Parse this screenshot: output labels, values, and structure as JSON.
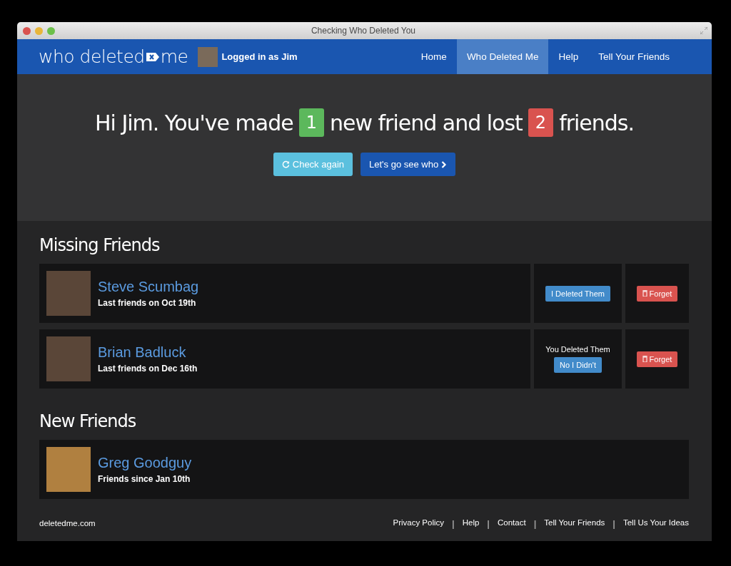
{
  "window": {
    "title": "Checking Who Deleted You"
  },
  "navbar": {
    "logo_left": "who deleted",
    "logo_right": "me",
    "login_prefix": "Logged in as",
    "login_user": "Jim",
    "items": [
      {
        "label": "Home",
        "selected": false
      },
      {
        "label": "Who Deleted Me",
        "selected": true
      },
      {
        "label": "Help",
        "selected": false
      },
      {
        "label": "Tell Your Friends",
        "selected": false
      }
    ]
  },
  "hero": {
    "headline": [
      {
        "kind": "text",
        "text": "Hi Jim. You've made"
      },
      {
        "kind": "badge",
        "text": "1",
        "color": "#5cb85c"
      },
      {
        "kind": "text",
        "text": "new friend and lost"
      },
      {
        "kind": "badge",
        "text": "2",
        "color": "#d9534f"
      },
      {
        "kind": "text",
        "text": "friends."
      }
    ],
    "check_button": "Check again",
    "go_button": "Let's go see who"
  },
  "missing": {
    "title": "Missing Friends",
    "rows": [
      {
        "name": "Steve Scumbag",
        "detail": "Last friends on Oct 19th",
        "kind": "action",
        "button": "I Deleted Them",
        "forget": "Forget"
      },
      {
        "name": "Brian Badluck",
        "detail": "Last friends on Dec 16th",
        "kind": "status",
        "status": "You Deleted Them",
        "button": "No I Didn't",
        "forget": "Forget"
      }
    ]
  },
  "new": {
    "title": "New Friends",
    "rows": [
      {
        "name": "Greg Goodguy",
        "detail": "Friends since Jan 10th"
      }
    ]
  },
  "footer": {
    "site": "deletedme.com",
    "items": [
      {
        "kind": "link",
        "text": "Privacy Policy"
      },
      {
        "kind": "sep",
        "text": "|"
      },
      {
        "kind": "link",
        "text": "Help"
      },
      {
        "kind": "sep",
        "text": "|"
      },
      {
        "kind": "link",
        "text": "Contact"
      },
      {
        "kind": "sep",
        "text": "|"
      },
      {
        "kind": "link",
        "text": "Tell Your Friends"
      },
      {
        "kind": "sep",
        "text": "|"
      },
      {
        "kind": "link",
        "text": "Tell Us Your Ideas"
      }
    ]
  }
}
